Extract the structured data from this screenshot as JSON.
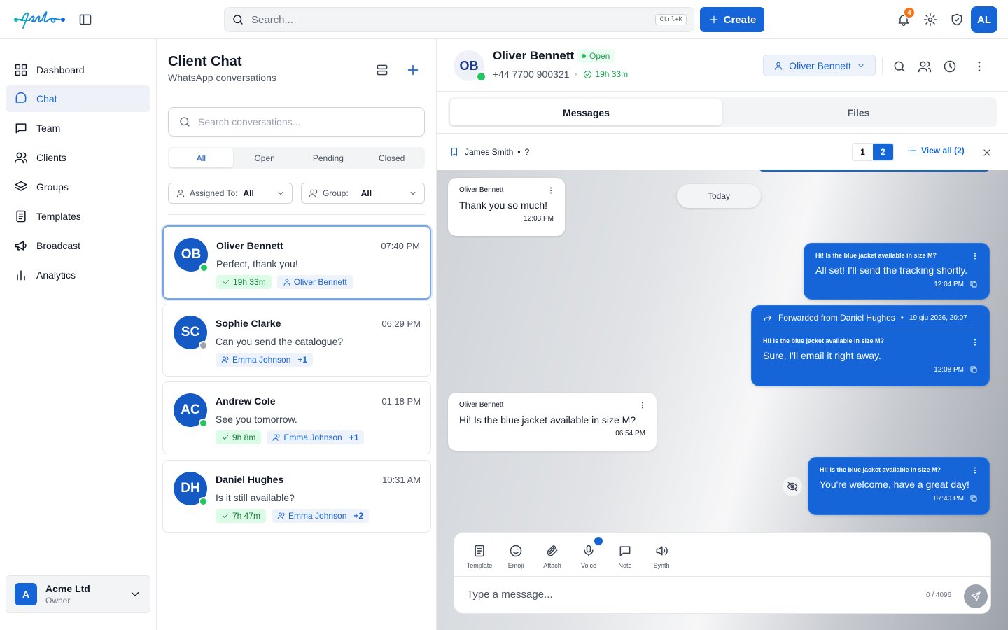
{
  "header": {
    "logo_text": "feelo",
    "search_placeholder": "Search...",
    "search_shortcut": "Ctrl+K",
    "create_label": "Create",
    "notification_count": "4",
    "user_initials": "AL"
  },
  "sidebar": {
    "items": [
      {
        "label": "Dashboard",
        "icon": "grid-icon"
      },
      {
        "label": "Chat",
        "icon": "chat-icon",
        "active": true
      },
      {
        "label": "Team",
        "icon": "message-square-icon"
      },
      {
        "label": "Clients",
        "icon": "users-icon"
      },
      {
        "label": "Groups",
        "icon": "layers-icon"
      },
      {
        "label": "Templates",
        "icon": "file-text-icon"
      },
      {
        "label": "Broadcast",
        "icon": "megaphone-icon"
      },
      {
        "label": "Analytics",
        "icon": "bar-chart-icon"
      }
    ],
    "org": {
      "initial": "A",
      "name": "Acme Ltd",
      "role": "Owner"
    }
  },
  "list": {
    "title": "Client Chat",
    "subtitle": "WhatsApp conversations",
    "search_placeholder": "Search conversations...",
    "status_tabs": [
      "All",
      "Open",
      "Pending",
      "Closed"
    ],
    "filters": {
      "assigned_label": "Assigned To:",
      "assigned_value": "All",
      "group_label": "Group:",
      "group_value": "All"
    },
    "conversations": [
      {
        "initials": "OB",
        "name": "Oliver Bennett",
        "time": "07:40 PM",
        "message": "Perfect, thank you!",
        "timer": "19h 33m",
        "assignee": "Oliver Bennett",
        "online": true
      },
      {
        "initials": "SC",
        "name": "Sophie Clarke",
        "time": "06:29 PM",
        "message": "Can you send the catalogue?",
        "assignee": "Emma Johnson",
        "extra": "+1",
        "online": false
      },
      {
        "initials": "AC",
        "name": "Andrew Cole",
        "time": "01:18 PM",
        "message": "See you tomorrow.",
        "timer": "9h 8m",
        "assignee": "Emma Johnson",
        "extra": "+1",
        "online": true
      },
      {
        "initials": "DH",
        "name": "Daniel Hughes",
        "time": "10:31 AM",
        "message": "Is it still available?",
        "timer": "7h 47m",
        "assignee": "Emma Johnson",
        "extra": "+2",
        "online": true
      }
    ]
  },
  "chat": {
    "initials": "OB",
    "name": "Oliver Bennett",
    "status": "Open",
    "phone": "+44 7700 900321",
    "timer": "19h 33m",
    "agent": "Oliver Bennett",
    "tabs": [
      "Messages",
      "Files"
    ],
    "pinned": {
      "name": "James Smith",
      "extra": "?",
      "pages": [
        "1",
        "2"
      ],
      "view_all": "View all (2)"
    },
    "date_divider": "Today",
    "messages": [
      {
        "sender": "Oliver Bennett",
        "text": "Thank you so much!",
        "time": "12:03 PM"
      },
      {
        "quote": "Hi! Is the blue jacket available in size M?",
        "text": "All set! I'll send the tracking shortly.",
        "time": "12:04 PM"
      },
      {
        "forwarded": "Forwarded from Daniel Hughes",
        "forwarded_date": "19 giu 2026, 20:07",
        "quote": "Hi! Is the blue jacket available in size M?",
        "text": "Sure, I'll email it right away.",
        "time": "12:08 PM"
      },
      {
        "sender": "Oliver Bennett",
        "text": "Hi! Is the blue jacket available in size M?",
        "time": "06:54 PM"
      },
      {
        "quote": "Hi! Is the blue jacket available in size M?",
        "text": "You're welcome, have a great day!",
        "time": "07:40 PM"
      }
    ],
    "composer": {
      "tools": [
        "Template",
        "Emoji",
        "Attach",
        "Voice",
        "Note",
        "Synth"
      ],
      "placeholder": "Type a message...",
      "counter": "0 / 4096"
    }
  }
}
